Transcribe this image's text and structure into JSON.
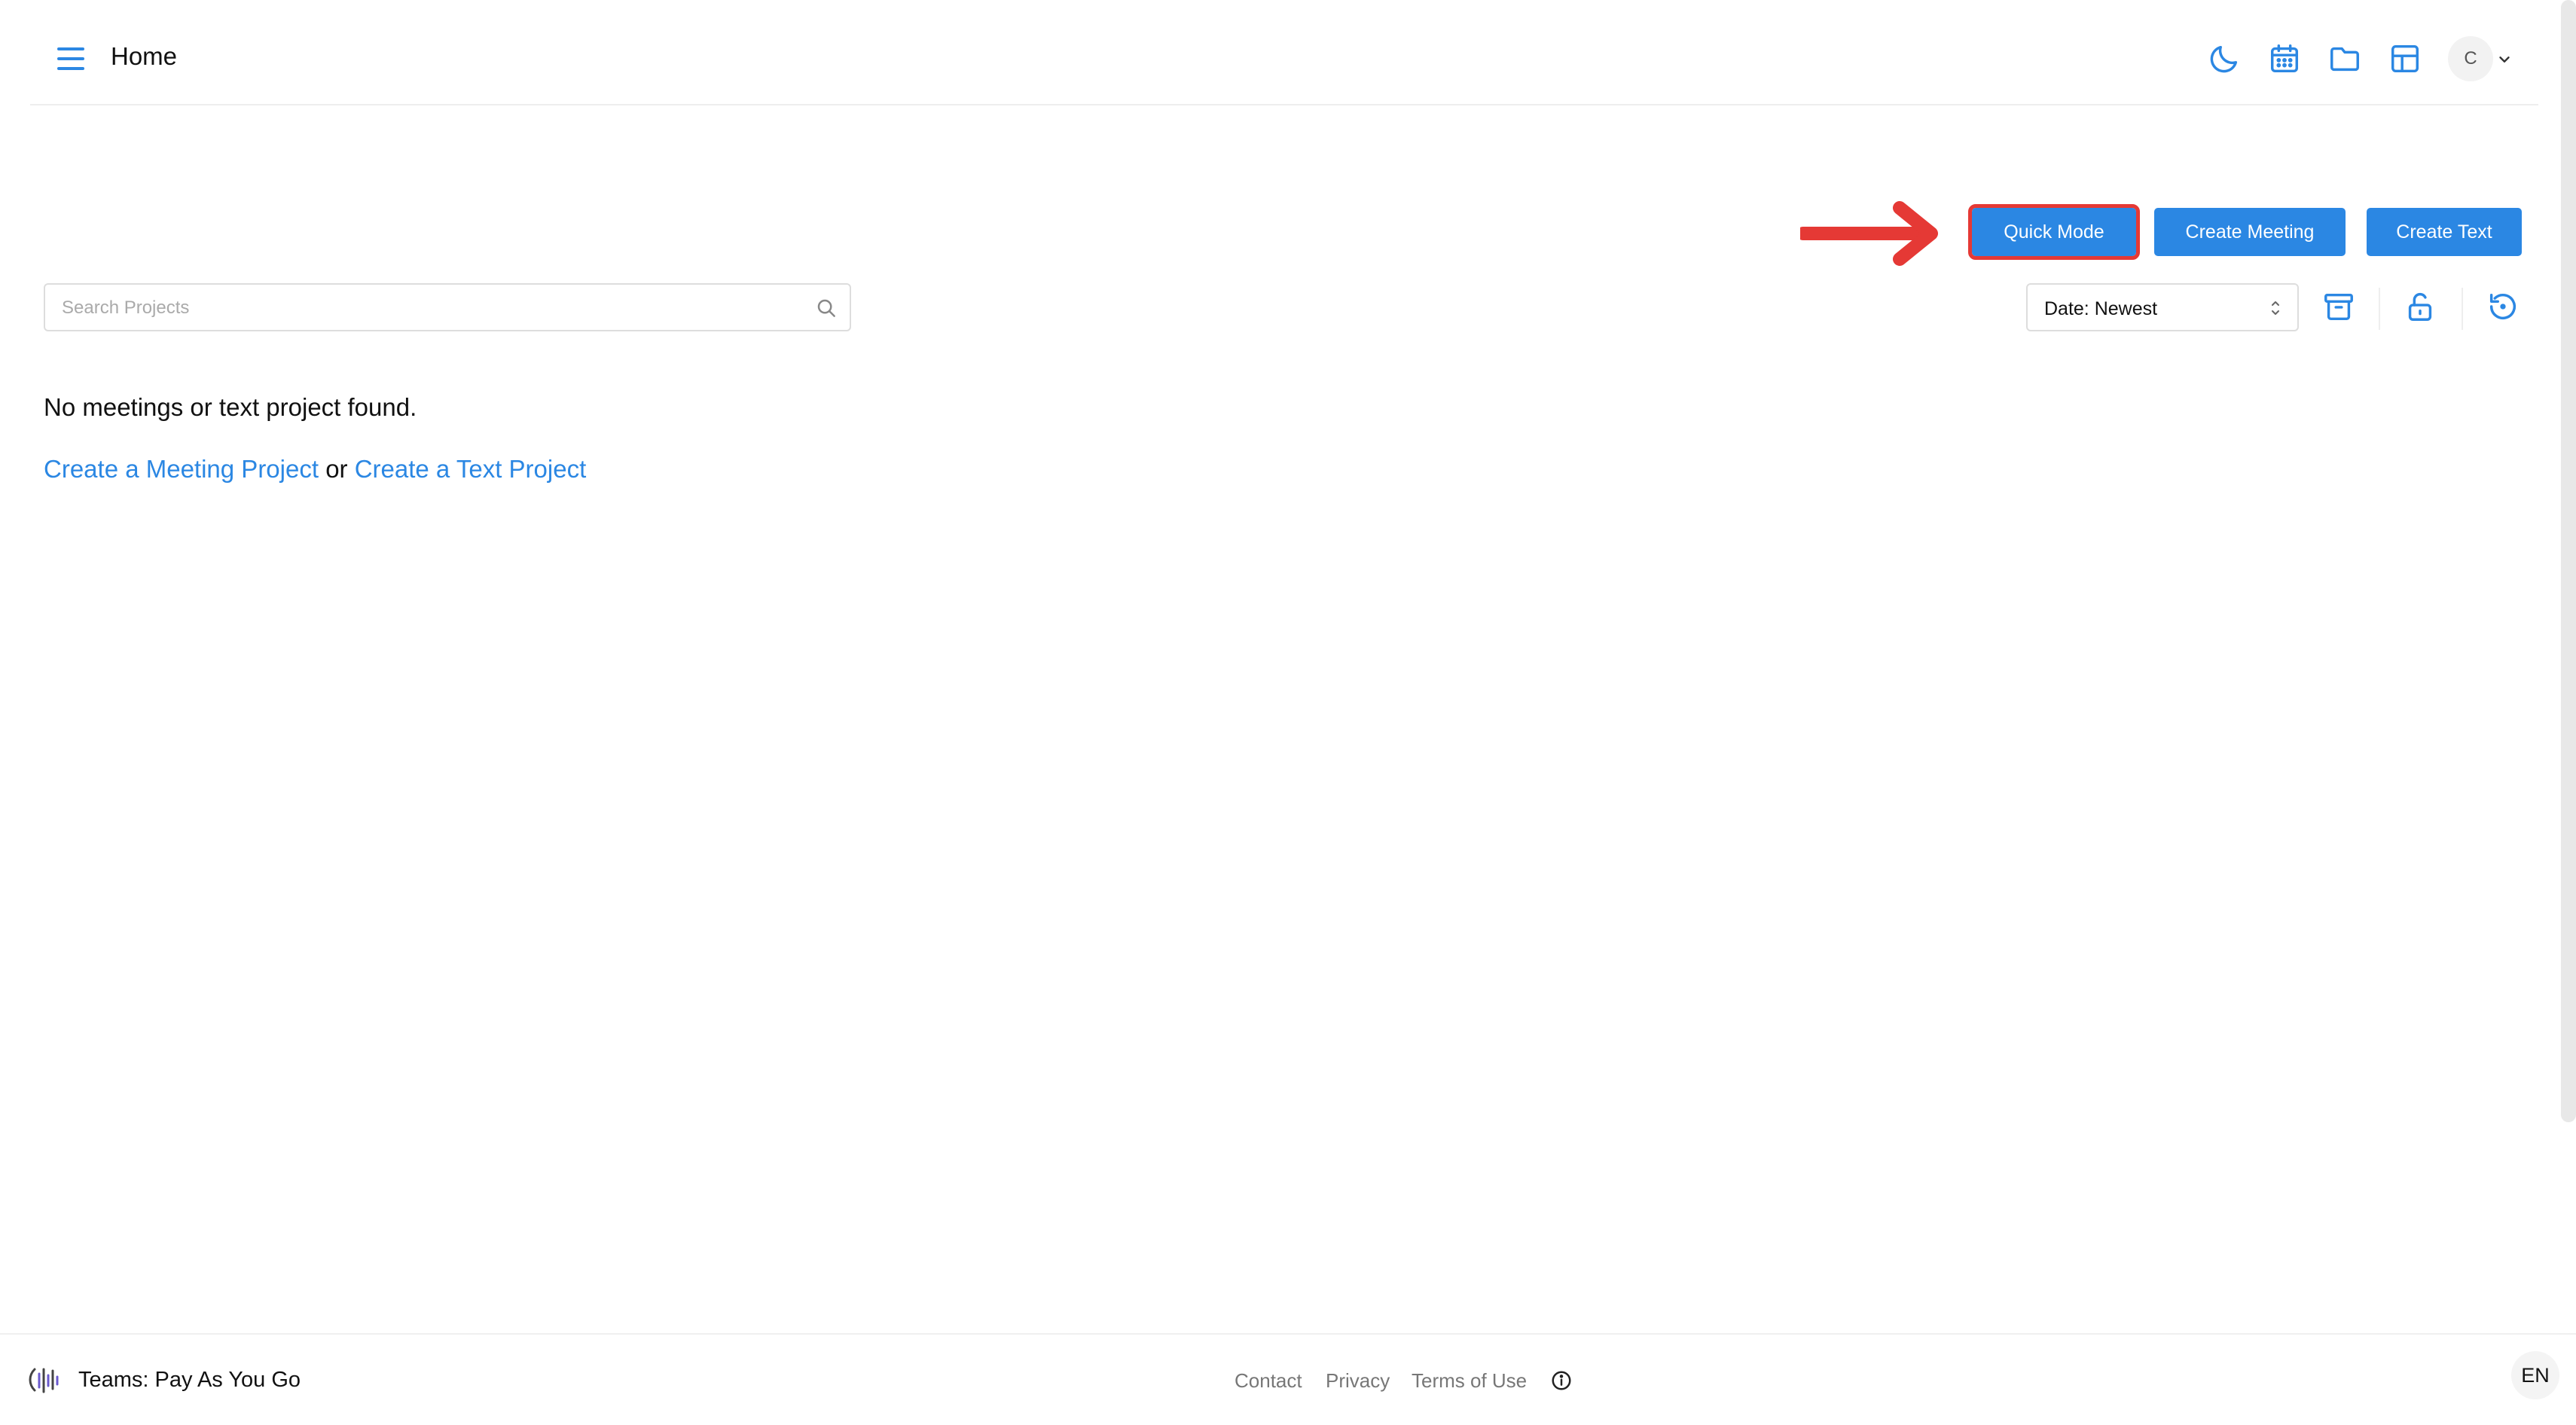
{
  "header": {
    "title": "Home",
    "avatar_initial": "C",
    "icons": [
      "menu-icon",
      "moon-icon",
      "calendar-icon",
      "folder-icon",
      "layout-grid-icon",
      "chevron-down-icon"
    ]
  },
  "actions": {
    "quick_mode": "Quick Mode",
    "create_meeting": "Create Meeting",
    "create_text": "Create Text"
  },
  "search": {
    "placeholder": "Search Projects",
    "value": ""
  },
  "sort": {
    "selected": "Date: Newest"
  },
  "empty_state": {
    "message": "No meetings or text project found.",
    "link_meeting": "Create a Meeting Project",
    "connector": "or",
    "link_text": "Create a Text Project"
  },
  "footer": {
    "team": "Teams: Pay As You Go",
    "links": [
      "Contact",
      "Privacy",
      "Terms of Use"
    ],
    "language": "EN"
  },
  "colors": {
    "accent": "#2b87e3",
    "annotation": "#e53935"
  }
}
